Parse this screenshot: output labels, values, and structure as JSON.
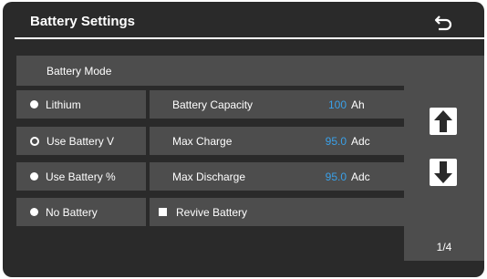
{
  "header": {
    "title": "Battery Settings",
    "back_icon": "back-arrow-icon"
  },
  "battery_mode": {
    "title": "Battery Mode",
    "options": [
      {
        "label": "Lithium",
        "selected": false
      },
      {
        "label": "Use Battery V",
        "selected": true
      },
      {
        "label": "Use Battery %",
        "selected": false
      },
      {
        "label": "No Battery",
        "selected": false
      }
    ]
  },
  "params": [
    {
      "label": "Battery Capacity",
      "value": "100",
      "unit": "Ah"
    },
    {
      "label": "Max Charge",
      "value": "95.0",
      "unit": "Adc"
    },
    {
      "label": "Max Discharge",
      "value": "95.0",
      "unit": "Adc"
    }
  ],
  "revive": {
    "label": "Revive Battery",
    "checked": false
  },
  "nav": {
    "page": "1/4",
    "up_icon": "arrow-up-icon",
    "down_icon": "arrow-down-icon"
  },
  "colors": {
    "background": "#2a2a2a",
    "panel": "#4d4d4d",
    "value": "#3aa0e8",
    "text": "#ffffff"
  }
}
